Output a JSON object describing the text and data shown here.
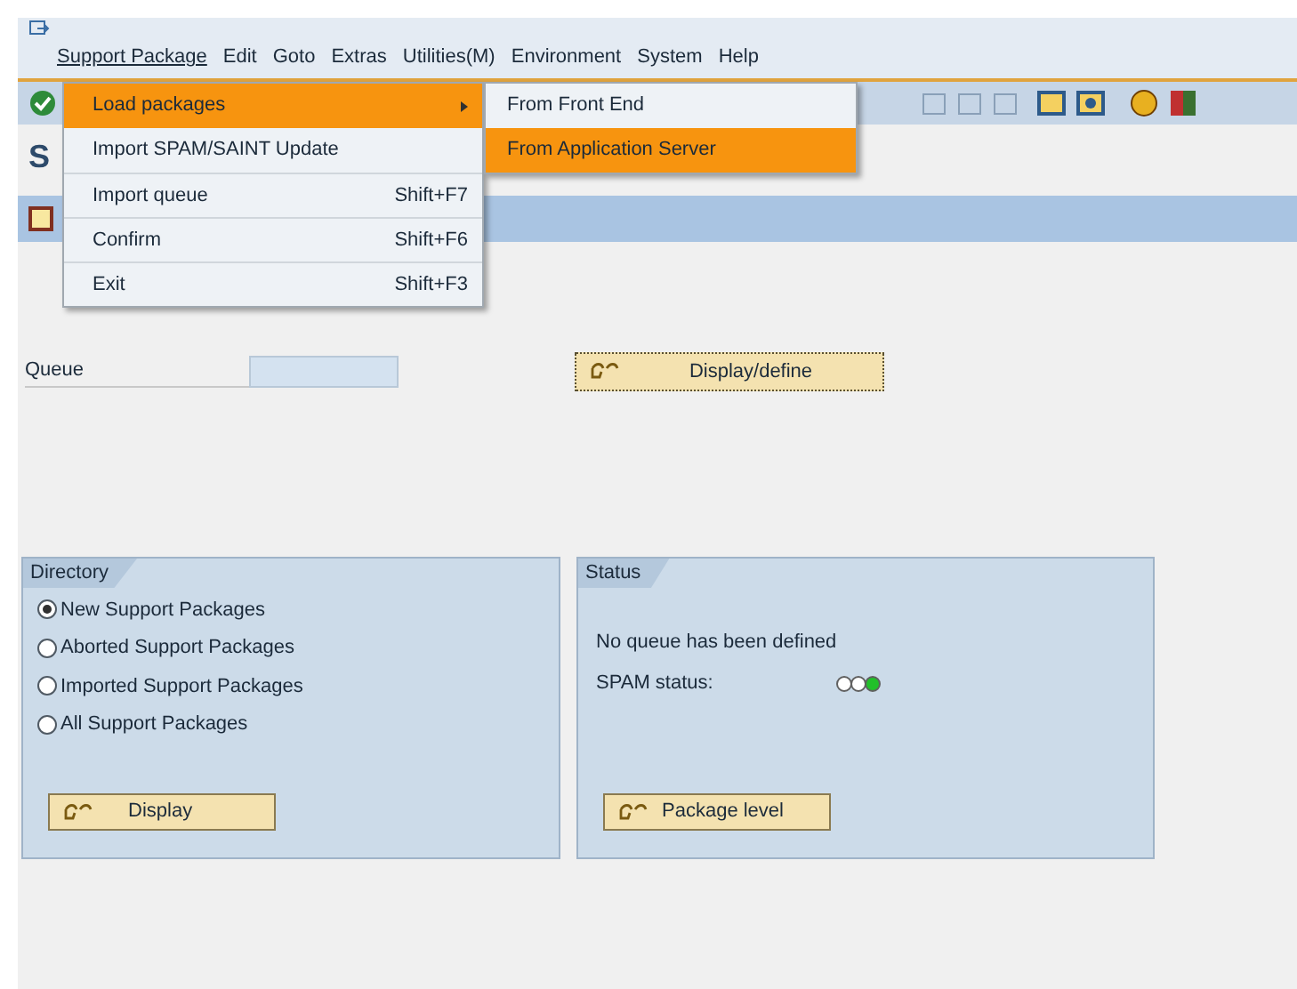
{
  "menu_bar": [
    {
      "label": "Support Package",
      "selected": true
    },
    {
      "label": "Edit",
      "selected": false
    },
    {
      "label": "Goto",
      "selected": false
    },
    {
      "label": "Extras",
      "selected": false
    },
    {
      "label": "Utilities(M)",
      "selected": false
    },
    {
      "label": "Environment",
      "selected": false
    },
    {
      "label": "System",
      "selected": false
    },
    {
      "label": "Help",
      "selected": false
    }
  ],
  "dropdown": {
    "items": [
      {
        "label": "Load packages",
        "has_submenu": true,
        "selected": true
      },
      {
        "label": "Import SPAM/SAINT Update",
        "has_submenu": false,
        "selected": false
      },
      {
        "label": "Import queue",
        "shortcut": "Shift+F7",
        "has_submenu": false,
        "selected": false
      },
      {
        "label": "Confirm",
        "shortcut": "Shift+F6",
        "has_submenu": false,
        "selected": false
      },
      {
        "label": "Exit",
        "shortcut": "Shift+F3",
        "has_submenu": false,
        "selected": false
      }
    ],
    "submenu": [
      {
        "label": "From Front End",
        "selected": false
      },
      {
        "label": "From Application Server",
        "selected": true
      }
    ]
  },
  "title": {
    "start": "S"
  },
  "queue": {
    "label": "Queue"
  },
  "display_define_button": "Display/define",
  "directory": {
    "title": "Directory",
    "options": [
      {
        "label": "New Support Packages",
        "selected": true
      },
      {
        "label": "Aborted Support Packages",
        "selected": false
      },
      {
        "label": "Imported Support Packages",
        "selected": false
      },
      {
        "label": "All Support Packages",
        "selected": false
      }
    ],
    "button": "Display"
  },
  "status": {
    "title": "Status",
    "message": "No queue has been defined",
    "spam_label": "SPAM status:",
    "lights": [
      {
        "color": "#ffffff"
      },
      {
        "color": "#ffffff"
      },
      {
        "color": "#22c02a"
      }
    ],
    "button": "Package level"
  }
}
